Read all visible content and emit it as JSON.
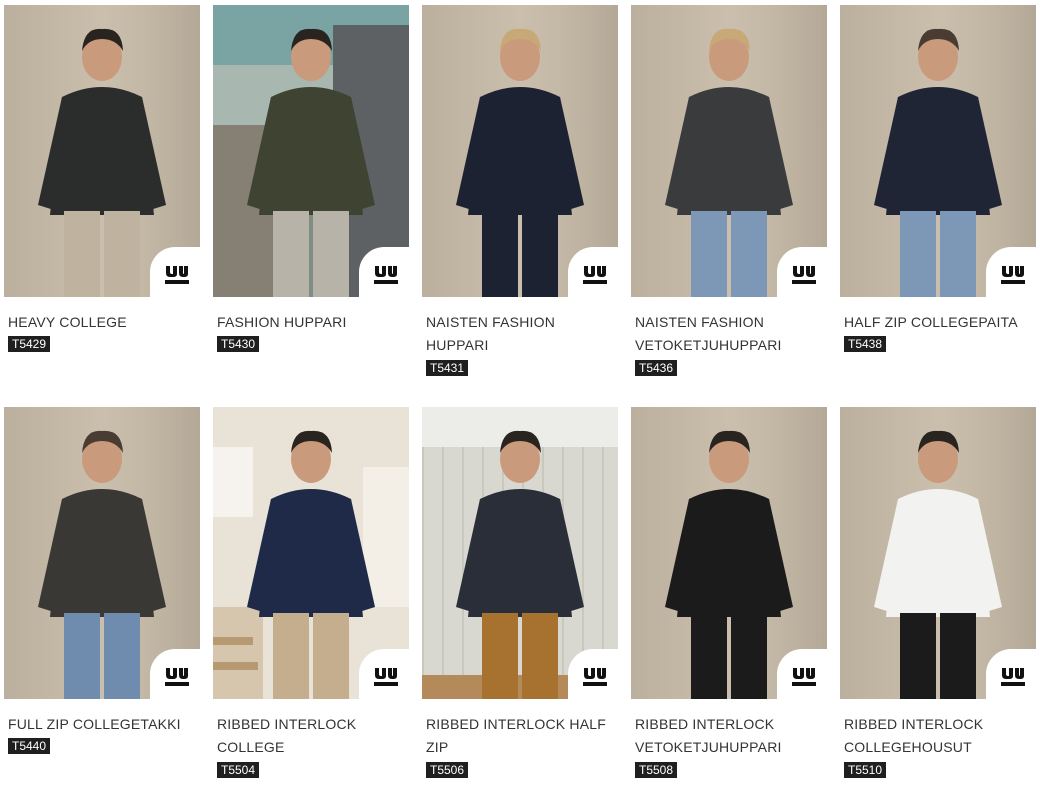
{
  "brand_badge": "TEE JAYS",
  "products": [
    {
      "name": "HEAVY COLLEGE",
      "code": "T5429",
      "scene": "neutral-wall",
      "garment": "#2b2d2c",
      "pants": "#bfb3a0",
      "hair": "#2a2420"
    },
    {
      "name": "FASHION HUPPARI",
      "code": "T5430",
      "scene": "sea-rocks",
      "garment": "#3f4432",
      "pants": "#b8b3a8",
      "hair": "#2a2420"
    },
    {
      "name": "NAISTEN FASHION HUPPARI",
      "code": "T5431",
      "scene": "neutral-wall",
      "garment": "#1d2232",
      "pants": "#1d2232",
      "hair": "#c7a877"
    },
    {
      "name": "NAISTEN FASHION VETOKETJUHUPPARI",
      "code": "T5436",
      "scene": "neutral-wall",
      "garment": "#3a3b3c",
      "pants": "#7d97b6",
      "hair": "#c7a877"
    },
    {
      "name": "HALF ZIP COLLEGEPAITA",
      "code": "T5438",
      "scene": "neutral-wall",
      "garment": "#1f2535",
      "pants": "#7d97b6",
      "hair": "#4a3c32"
    },
    {
      "name": "FULL ZIP COLLEGETAKKI",
      "code": "T5440",
      "scene": "neutral-wall",
      "garment": "#3a3835",
      "pants": "#6f8cae",
      "hair": "#4a3c32"
    },
    {
      "name": "RIBBED INTERLOCK COLLEGE",
      "code": "T5504",
      "scene": "stairs",
      "garment": "#1e2a48",
      "pants": "#c4ae8d",
      "hair": "#2a2420"
    },
    {
      "name": "RIBBED INTERLOCK HALF ZIP",
      "code": "T5506",
      "scene": "panel-wall",
      "garment": "#2a2e38",
      "pants": "#a7722f",
      "hair": "#2a2420"
    },
    {
      "name": "RIBBED INTERLOCK VETOKETJUHUPPARI",
      "code": "T5508",
      "scene": "neutral-wall",
      "garment": "#1b1b1c",
      "pants": "#1b1b1c",
      "hair": "#2a2420"
    },
    {
      "name": "RIBBED INTERLOCK COLLEGEHOUSUT",
      "code": "T5510",
      "scene": "neutral-wall",
      "garment": "#f2f2f0",
      "pants": "#1b1b1c",
      "hair": "#2a2420"
    }
  ]
}
